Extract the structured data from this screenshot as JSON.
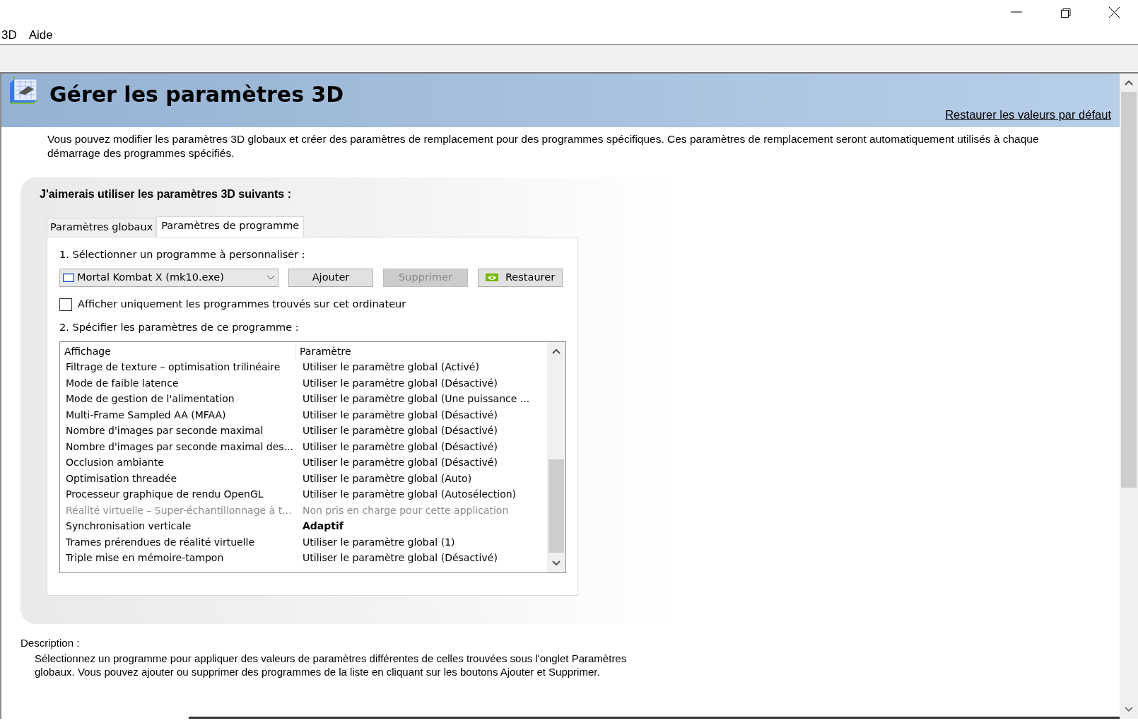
{
  "menu": [
    "3D",
    "Aide"
  ],
  "header": {
    "title": "Gérer les paramètres 3D",
    "restore_link": "Restaurer les valeurs par défaut"
  },
  "intro": "Vous pouvez modifier les paramètres 3D globaux et créer des paramètres de remplacement pour des programmes spécifiques. Ces paramètres de remplacement seront automatiquement utilisés à chaque démarrage des programmes spécifiés.",
  "panel": {
    "heading": "J'aimerais utiliser les paramètres 3D suivants :",
    "tabs": [
      {
        "label": "Paramètres globaux",
        "selected": false
      },
      {
        "label": "Paramètres de programme",
        "selected": true
      }
    ],
    "step1": "1. Sélectionner un programme à personnaliser :",
    "program": "Mortal Kombat X (mk10.exe)",
    "buttons": [
      {
        "label": "Ajouter",
        "disabled": false,
        "kind": "plain"
      },
      {
        "label": "Supprimer",
        "disabled": true,
        "kind": "plain"
      },
      {
        "label": "Restaurer",
        "disabled": false,
        "kind": "logo"
      }
    ],
    "filter_checkbox": {
      "label": "Afficher uniquement les programmes trouvés sur cet ordinateur",
      "checked": false
    },
    "step2": "2. Spécifier les paramètres de ce programme :",
    "table": {
      "columns": [
        "Affichage",
        "Paramètre"
      ],
      "rows": [
        {
          "feature": "Filtrage de texture – optimisation trilinéaire",
          "setting": "Utiliser le paramètre global (Activé)",
          "disabled": false,
          "modified": false
        },
        {
          "feature": "Mode de faible latence",
          "setting": "Utiliser le paramètre global (Désactivé)",
          "disabled": false,
          "modified": false
        },
        {
          "feature": "Mode de gestion de l'alimentation",
          "setting": "Utiliser le paramètre global (Une puissance ...",
          "disabled": false,
          "modified": false
        },
        {
          "feature": "Multi-Frame Sampled AA (MFAA)",
          "setting": "Utiliser le paramètre global (Désactivé)",
          "disabled": false,
          "modified": false
        },
        {
          "feature": "Nombre d'images par seconde maximal",
          "setting": "Utiliser le paramètre global (Désactivé)",
          "disabled": false,
          "modified": false
        },
        {
          "feature": "Nombre d'images par seconde maximal des...",
          "setting": "Utiliser le paramètre global (Désactivé)",
          "disabled": false,
          "modified": false
        },
        {
          "feature": "Occlusion ambiante",
          "setting": "Utiliser le paramètre global (Désactivé)",
          "disabled": false,
          "modified": false
        },
        {
          "feature": "Optimisation threadée",
          "setting": "Utiliser le paramètre global (Auto)",
          "disabled": false,
          "modified": false
        },
        {
          "feature": "Processeur graphique de rendu OpenGL",
          "setting": "Utiliser le paramètre global (Autosélection)",
          "disabled": false,
          "modified": false
        },
        {
          "feature": "Réalité virtuelle – Super-échantillonnage à t...",
          "setting": "Non pris en charge pour cette application",
          "disabled": true,
          "modified": false
        },
        {
          "feature": "Synchronisation verticale",
          "setting": "Adaptif",
          "disabled": false,
          "modified": true
        },
        {
          "feature": "Trames prérendues de réalité virtuelle",
          "setting": "Utiliser le paramètre global (1)",
          "disabled": false,
          "modified": false
        },
        {
          "feature": "Triple mise en mémoire-tampon",
          "setting": "Utiliser le paramètre global (Désactivé)",
          "disabled": false,
          "modified": false
        }
      ]
    }
  },
  "description": {
    "label": "Description :",
    "text": "Sélectionnez un programme pour appliquer des valeurs de paramètres différentes de celles trouvées sous l'onglet Paramètres globaux. Vous pouvez ajouter ou supprimer des programmes de la liste en cliquant sur les boutons Ajouter et Supprimer."
  }
}
